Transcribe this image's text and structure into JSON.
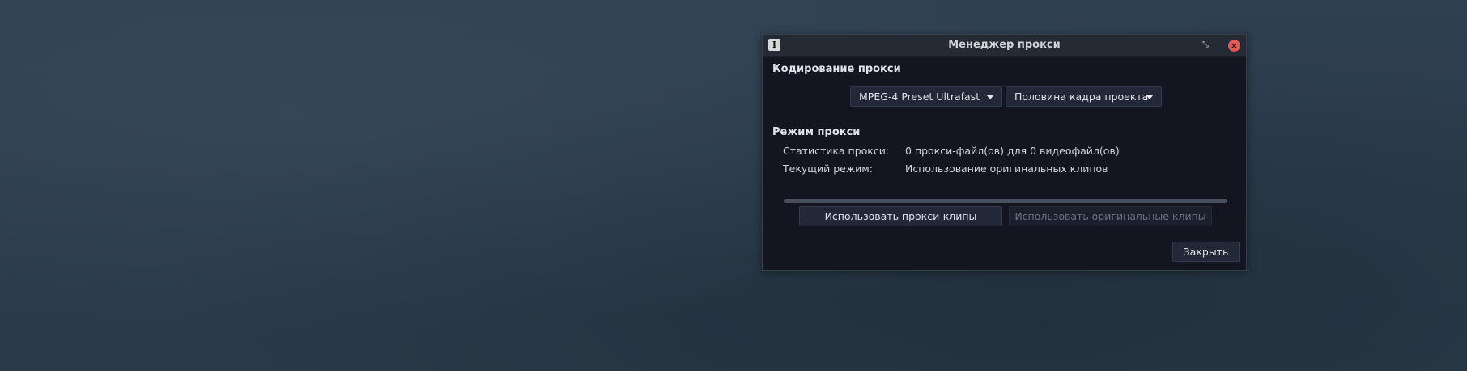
{
  "window": {
    "title": "Менеджер прокси",
    "app_icon": "app-icon",
    "restore_icon": "restore-icon",
    "close_icon": "close-icon"
  },
  "encoding": {
    "section_label": "Кодирование прокси",
    "preset_value": "MPEG-4 Preset Ultrafast",
    "resolution_value": "Половина кадра проекта"
  },
  "mode": {
    "section_label": "Режим прокси",
    "stats_label": "Статистика прокси:",
    "stats_value": "0 прокси-файл(ов) для 0 видеофайл(ов)",
    "current_label": "Текущий режим:",
    "current_value": "Использование оригинальных клипов",
    "progress": 0
  },
  "buttons": {
    "use_proxy": "Использовать прокси-клипы",
    "use_original": "Использовать оригинальные клипы",
    "close": "Закрыть"
  },
  "colors": {
    "accent_close": "#e05a5a",
    "window_bg": "#131620"
  }
}
